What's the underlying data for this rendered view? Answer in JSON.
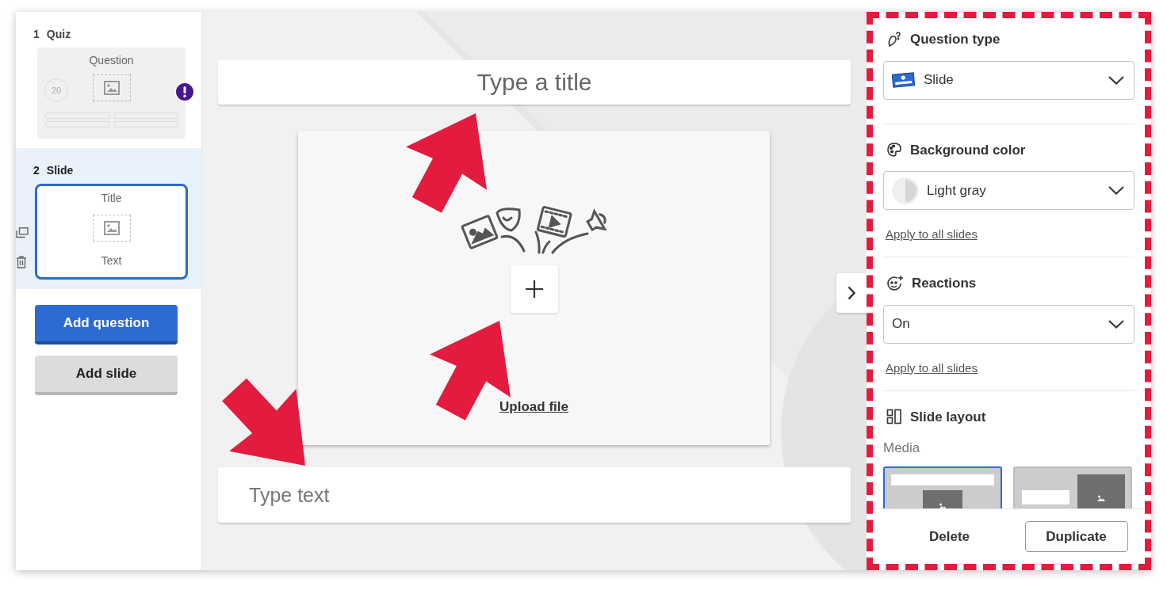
{
  "slides": [
    {
      "number": "1",
      "kind": "quiz",
      "title": "Quiz",
      "selected": false,
      "heading": "Question",
      "timer": "20",
      "warning": true
    },
    {
      "number": "2",
      "kind": "slide",
      "title": "Slide",
      "selected": true,
      "heading": "Title",
      "body": "Text"
    }
  ],
  "sidebar_buttons": [
    {
      "label": "Add question",
      "kind": "primary"
    },
    {
      "label": "Add slide",
      "kind": "secondary"
    }
  ],
  "editor": {
    "title_placeholder": "Type a title",
    "upload_label": "Upload file",
    "text_placeholder": "Type text"
  },
  "panel": {
    "sections": [
      {
        "kind": "question_type",
        "heading": "Question type",
        "value": "Slide"
      },
      {
        "kind": "background",
        "heading": "Background color",
        "value": "Light gray",
        "link": "Apply to all slides"
      },
      {
        "kind": "reactions",
        "heading": "Reactions",
        "value": "On",
        "link": "Apply to all slides"
      },
      {
        "kind": "layout",
        "heading": "Slide layout",
        "label": "Media",
        "layouts": [
          {
            "kind": "top",
            "selected": true
          },
          {
            "kind": "side",
            "selected": false
          }
        ]
      }
    ],
    "footer": [
      "Delete",
      "Duplicate"
    ]
  }
}
